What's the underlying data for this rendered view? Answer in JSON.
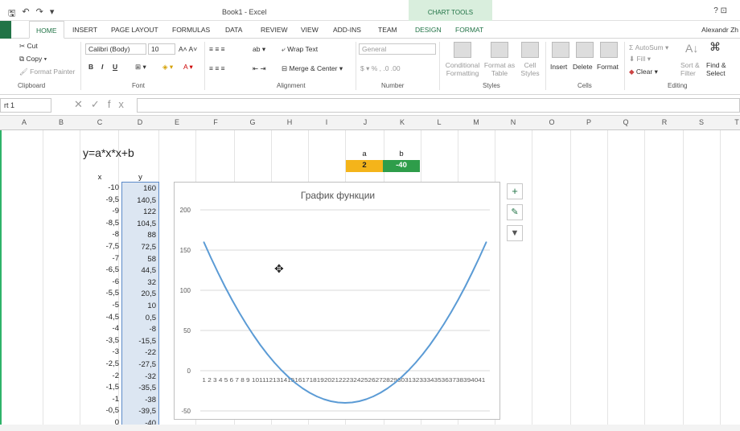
{
  "window": {
    "title": "Book1 - Excel",
    "context_tab_group": "CHART TOOLS",
    "help": "? ⊡",
    "user": "Alexandr Zh"
  },
  "tabs": [
    "HOME",
    "INSERT",
    "PAGE LAYOUT",
    "FORMULAS",
    "DATA",
    "REVIEW",
    "VIEW",
    "ADD-INS",
    "TEAM",
    "DESIGN",
    "FORMAT"
  ],
  "ribbon": {
    "clipboard": {
      "cut": "Cut",
      "copy": "Copy",
      "format_painter": "Format Painter",
      "label": "Clipboard"
    },
    "font": {
      "family": "Calibri (Body)",
      "size": "10",
      "label": "Font"
    },
    "alignment": {
      "wrap": "Wrap Text",
      "merge": "Merge & Center",
      "label": "Alignment"
    },
    "number": {
      "format": "General",
      "label": "Number"
    },
    "styles": {
      "conditional": "Conditional Formatting",
      "format_table": "Format as Table",
      "cell_styles": "Cell Styles",
      "label": "Styles"
    },
    "cells": {
      "insert": "Insert",
      "delete": "Delete",
      "format": "Format",
      "label": "Cells"
    },
    "editing": {
      "autosum": "AutoSum",
      "fill": "Fill",
      "clear": "Clear",
      "sort": "Sort & Filter",
      "find": "Find & Select",
      "label": "Editing"
    }
  },
  "formula_bar": {
    "name_box": "rt 1",
    "fx": "fx",
    "value": ""
  },
  "columns": [
    "A",
    "B",
    "C",
    "D",
    "E",
    "F",
    "G",
    "H",
    "I",
    "J",
    "K",
    "L",
    "M",
    "N",
    "O",
    "P",
    "Q",
    "R",
    "S",
    "T"
  ],
  "sheet": {
    "formula_title": "y=a*x*x+b",
    "param_a_label": "a",
    "param_b_label": "b",
    "param_a_value": "2",
    "param_b_value": "-40",
    "param_a_color": "#f4b41a",
    "param_b_color": "#2e9d4a",
    "x_header": "x",
    "y_header": "y",
    "x_values": [
      "-10",
      "-9,5",
      "-9",
      "-8,5",
      "-8",
      "-7,5",
      "-7",
      "-6,5",
      "-6",
      "-5,5",
      "-5",
      "-4,5",
      "-4",
      "-3,5",
      "-3",
      "-2,5",
      "-2",
      "-1,5",
      "-1",
      "-0,5",
      "0"
    ],
    "y_values": [
      "160",
      "140,5",
      "122",
      "104,5",
      "88",
      "72,5",
      "58",
      "44,5",
      "32",
      "20,5",
      "10",
      "0,5",
      "-8",
      "-15,5",
      "-22",
      "-27,5",
      "-32",
      "-35,5",
      "-38",
      "-39,5",
      "-40"
    ]
  },
  "chart_data": {
    "type": "line",
    "title": "График функции",
    "x": [
      1,
      2,
      3,
      4,
      5,
      6,
      7,
      8,
      9,
      10,
      11,
      12,
      13,
      14,
      15,
      16,
      17,
      18,
      19,
      20,
      21,
      22,
      23,
      24,
      25,
      26,
      27,
      28,
      29,
      30,
      31,
      32,
      33,
      34,
      35,
      36,
      37,
      38,
      39,
      40,
      41
    ],
    "xlabels": "1 2 3 4 5 6 7 8 9 1011121314151617181920212223242526272829303132333435363738394041",
    "series": [
      {
        "values": [
          160,
          140.5,
          122,
          104.5,
          88,
          72.5,
          58,
          44.5,
          32,
          20.5,
          10,
          0.5,
          -8,
          -15.5,
          -22,
          -27.5,
          -32,
          -35.5,
          -38,
          -39.5,
          -40,
          -39.5,
          -38,
          -35.5,
          -32,
          -27.5,
          -22,
          -15.5,
          -8,
          0.5,
          10,
          20.5,
          32,
          44.5,
          58,
          72.5,
          88,
          104.5,
          122,
          140.5,
          160
        ]
      }
    ],
    "yticks": [
      200,
      150,
      100,
      50,
      0,
      -50
    ],
    "ylim": [
      -50,
      200
    ],
    "line_color": "#5b9bd5",
    "grid": true
  }
}
